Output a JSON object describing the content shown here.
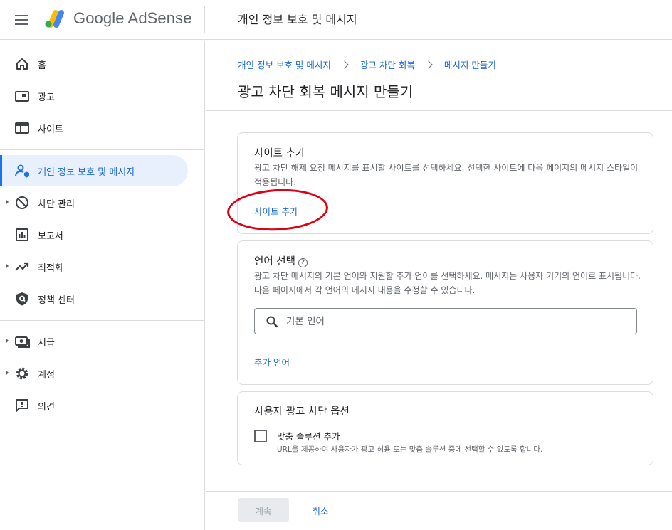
{
  "header": {
    "brand": "Google AdSense",
    "page_title": "개인 정보 보호 및 메시지"
  },
  "sidebar": {
    "items": [
      {
        "label": "홈",
        "icon": "home-icon"
      },
      {
        "label": "광고",
        "icon": "ads-icon"
      },
      {
        "label": "사이트",
        "icon": "sites-icon"
      },
      {
        "label": "개인 정보 보호 및 메시지",
        "icon": "privacy-icon",
        "active": true
      },
      {
        "label": "차단 관리",
        "icon": "block-icon"
      },
      {
        "label": "보고서",
        "icon": "reports-icon"
      },
      {
        "label": "최적화",
        "icon": "optimization-icon"
      },
      {
        "label": "정책 센터",
        "icon": "policy-shield-icon"
      },
      {
        "label": "지급",
        "icon": "payments-icon"
      },
      {
        "label": "계정",
        "icon": "gear-icon"
      },
      {
        "label": "의견",
        "icon": "feedback-icon"
      }
    ]
  },
  "breadcrumb": [
    "개인 정보 보호 및 메시지",
    "광고 차단 회복",
    "메시지 만들기"
  ],
  "main": {
    "title": "광고 차단 회복 메시지 만들기"
  },
  "site_card": {
    "title": "사이트 추가",
    "description": "광고 차단 해제 요청 메시지를 표시할 사이트를 선택하세요. 선택한 사이트에 다음 페이지의 메시지 스타일이 적용됩니다.",
    "link": "사이트 추가"
  },
  "language_card": {
    "title": "언어 선택",
    "help": "?",
    "description": "광고 차단 메시지의 기본 언어와 지원할 추가 언어를 선택하세요. 메시지는 사용자 기기의 언어로 표시됩니다. 다음 페이지에서 각 언어의 메시지 내용을 수정할 수 있습니다.",
    "search_placeholder": "기본 언어",
    "search_value": "",
    "link": "추가 언어"
  },
  "options_card": {
    "title": "사용자 광고 차단 옵션",
    "checkbox_label": "맞춤 솔루션 추가",
    "checkbox_checked": false,
    "checkbox_sub": "URL을 제공하여 사용자가 광고 허용 또는 맞춤 솔루션 중에 선택할 수 있도록 합니다."
  },
  "footer": {
    "continue_label": "계속",
    "cancel_label": "취소"
  },
  "colors": {
    "accent": "#1a73e8",
    "link": "#1967d2",
    "active_bg": "#e8f0fe",
    "annotation": "#e00016"
  }
}
